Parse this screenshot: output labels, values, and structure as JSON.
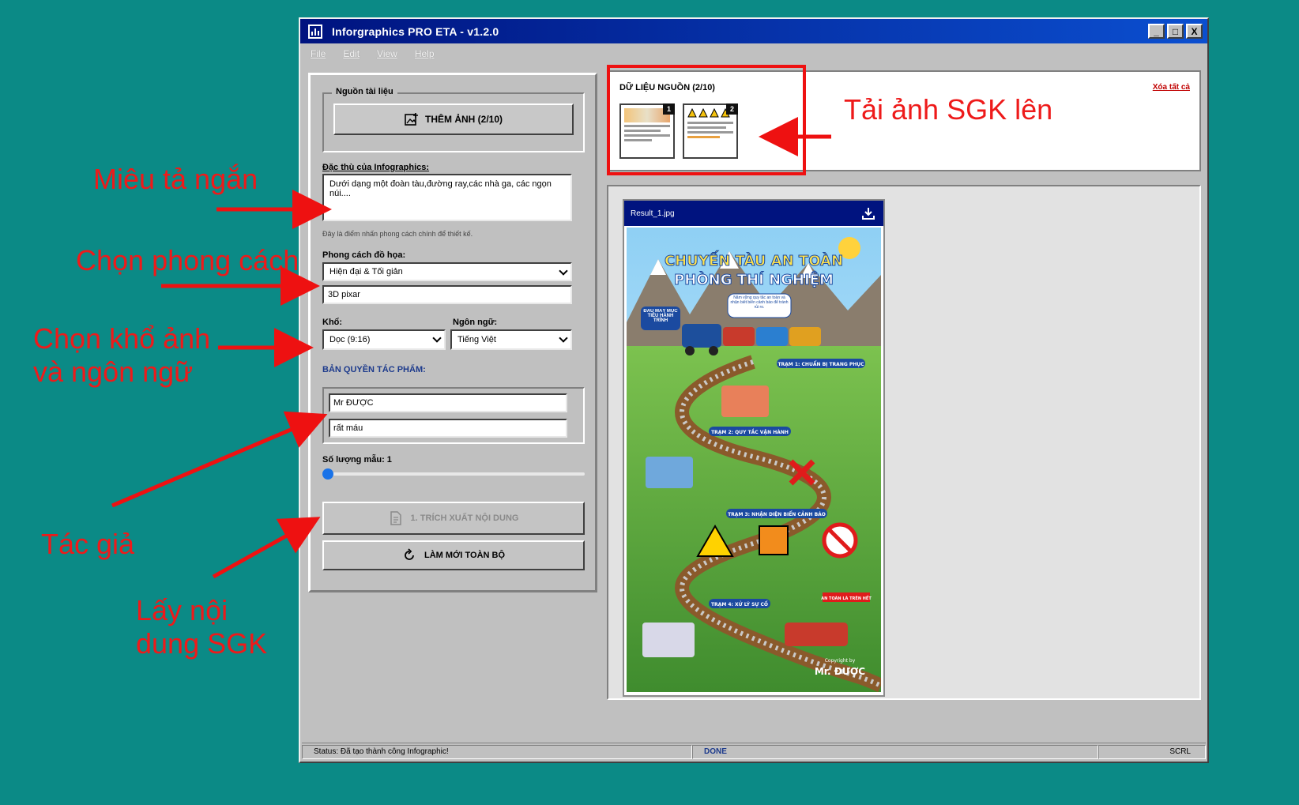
{
  "window": {
    "title": "Inforgraphics PRO ETA - v1.2.0",
    "buttons": [
      "_",
      "□",
      "X"
    ]
  },
  "menu": [
    "File",
    "Edit",
    "View",
    "Help"
  ],
  "left": {
    "source_group": "Nguồn tài liệu",
    "add_image_button": "THÊM ẢNH (2/10)",
    "desc_label": "Đặc thù của Infographics:",
    "desc_value": "Dưới dạng một đoàn tàu,đường ray,các nhà ga, các ngọn núi....",
    "desc_hint": "Đây là điểm nhấn phong cách chính để thiết kế.",
    "style_label": "Phong cách đồ họa:",
    "style_selected": "Hiện đại & Tối giản",
    "style_extra": "3D pixar",
    "size_label": "Khổ:",
    "size_selected": "Dọc (9:16)",
    "lang_label": "Ngôn ngữ:",
    "lang_selected": "Tiếng Việt",
    "copyright_label": "BẢN QUYỀN TÁC PHẨM:",
    "author": "Mr ĐƯỢC",
    "author_note": "rất máu",
    "samples_label": "Số lượng mẫu: 1",
    "samples_value": 1,
    "extract_button": "1. TRÍCH XUẤT NỘI DUNG",
    "reset_button": "LÀM MỚI TOÀN BỘ"
  },
  "source": {
    "title": "DỮ LIỆU NGUỒN (2/10)",
    "clear": "Xóa tất cả",
    "thumbs": [
      "1",
      "2"
    ]
  },
  "result": {
    "filename": "Result_1.jpg",
    "poster": {
      "title_line1": "CHUYẾN TÀU AN TOÀN",
      "title_line2": "PHÒNG THÍ NGHIỆM",
      "bubble": "Nắm vững quy tắc an toàn và nhận biết biển cảnh báo để tránh rủi ro.",
      "start_sign": "ĐẦU MÁY MỤC TIÊU HÀNH TRÌNH",
      "station1": "TRẠM 1: CHUẨN BỊ TRANG PHỤC",
      "station2": "TRẠM 2: QUY TẮC VẬN HÀNH",
      "station3": "TRẠM 3: NHẬN DIỆN BIỂN CẢNH BÁO",
      "station4": "TRẠM 4: XỬ LÝ SỰ CỐ",
      "flag": "AN TOÀN LÀ TRÊN HẾT",
      "copyright_small": "Copyright by",
      "copyright_name": "Mr. ĐƯỢC"
    }
  },
  "status": {
    "message": "Status: Đã tạo thành công Infographic!",
    "state": "DONE",
    "scrl": "SCRL"
  },
  "annotations": {
    "upload": "Tải ảnh SGK lên",
    "desc": "Miêu tả ngắn",
    "style": "Chọn phong cách",
    "size_lang_1": "Chọn khổ ảnh",
    "size_lang_2": "và ngôn ngữ",
    "author": "Tác giả",
    "extract_1": "Lấy nội",
    "extract_2": "dung SGK"
  },
  "colors": {
    "desktop": "#0b8a86",
    "annotation": "#ee1a1a",
    "title_bar": "#00137f",
    "accent": "#1a73e8"
  }
}
